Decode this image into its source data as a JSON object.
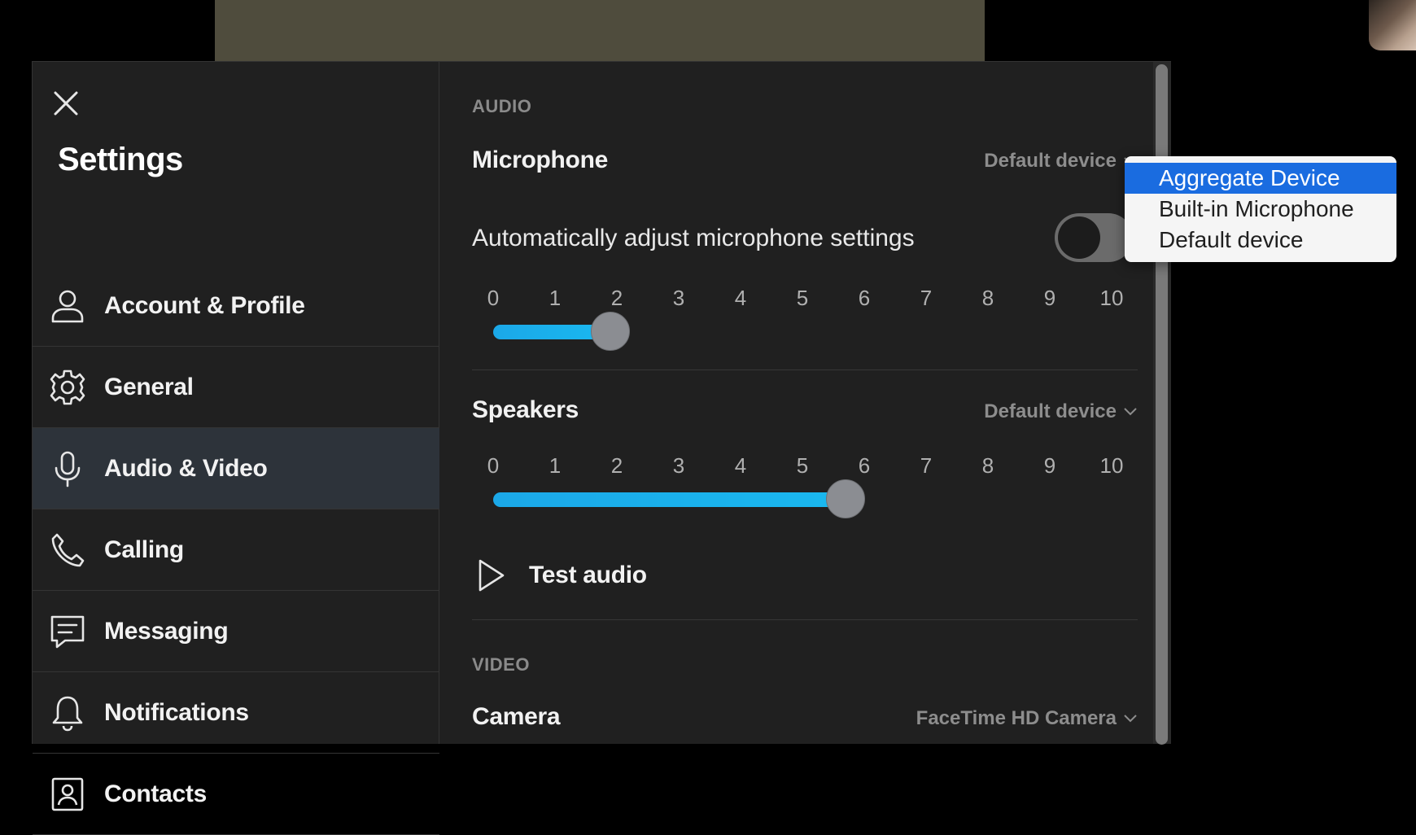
{
  "window": {
    "title": "Settings"
  },
  "sidebar": {
    "items": [
      {
        "label": "Account & Profile",
        "icon": "person-icon",
        "active": false
      },
      {
        "label": "General",
        "icon": "gear-icon",
        "active": false
      },
      {
        "label": "Audio & Video",
        "icon": "microphone-icon",
        "active": true
      },
      {
        "label": "Calling",
        "icon": "phone-icon",
        "active": false
      },
      {
        "label": "Messaging",
        "icon": "message-icon",
        "active": false
      },
      {
        "label": "Notifications",
        "icon": "bell-icon",
        "active": false
      },
      {
        "label": "Contacts",
        "icon": "contacts-icon",
        "active": false
      }
    ]
  },
  "audio": {
    "section_title": "AUDIO",
    "microphone": {
      "label": "Microphone",
      "device": "Default device",
      "auto_adjust_label": "Automatically adjust microphone settings",
      "auto_adjust_on": false,
      "level": 1.9,
      "scale": [
        "0",
        "1",
        "2",
        "3",
        "4",
        "5",
        "6",
        "7",
        "8",
        "9",
        "10"
      ]
    },
    "speakers": {
      "label": "Speakers",
      "device": "Default device",
      "level": 5.7,
      "scale": [
        "0",
        "1",
        "2",
        "3",
        "4",
        "5",
        "6",
        "7",
        "8",
        "9",
        "10"
      ]
    },
    "test_audio_label": "Test audio"
  },
  "video": {
    "section_title": "VIDEO",
    "camera": {
      "label": "Camera",
      "device": "FaceTime HD Camera"
    }
  },
  "microphone_dropdown": {
    "options": [
      "Aggregate Device",
      "Built-in Microphone",
      "Default device"
    ],
    "highlighted": "Aggregate Device"
  },
  "colors": {
    "accent": "#1ab0ec",
    "highlight": "#1a6ce0",
    "panel": "#202020",
    "active_item": "#2d333a"
  }
}
